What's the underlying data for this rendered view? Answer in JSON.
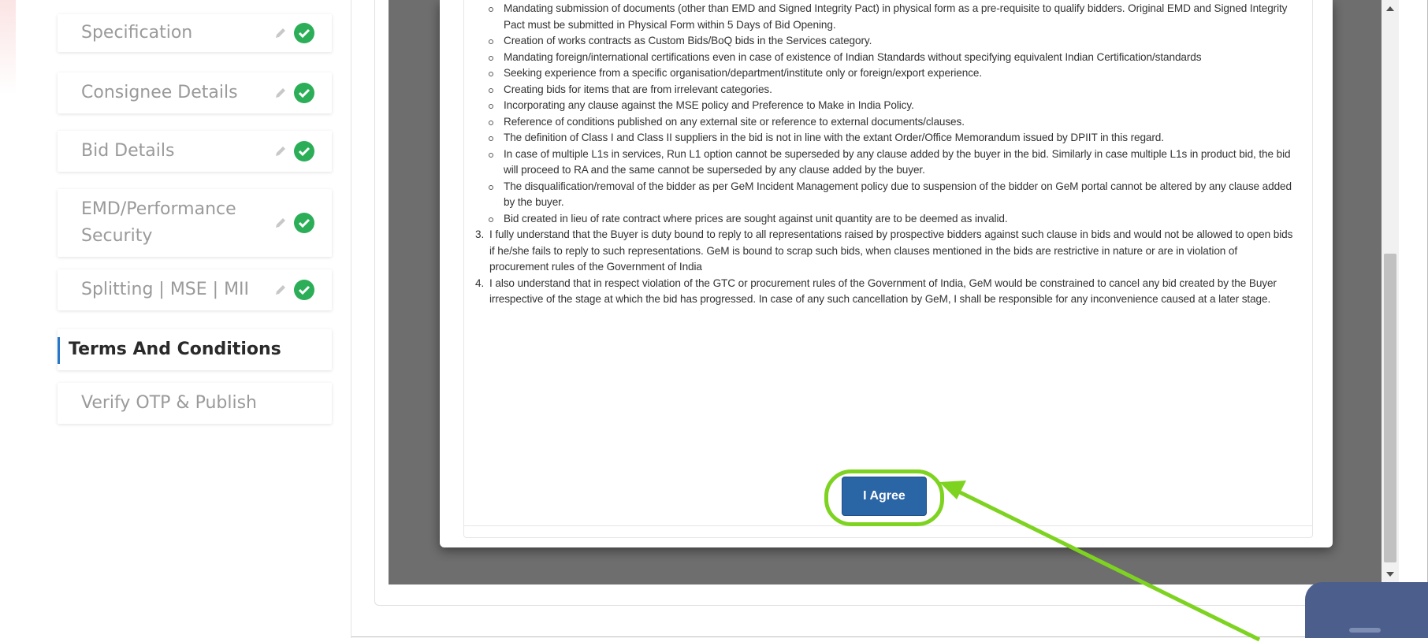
{
  "sidebar": {
    "steps": [
      {
        "label": "Specification"
      },
      {
        "label": "Consignee Details"
      },
      {
        "label": "Bid Details"
      },
      {
        "label": "EMD/Performance",
        "label2": "Security"
      },
      {
        "label": "Splitting | MSE | MII"
      },
      {
        "label": "Terms And Conditions"
      },
      {
        "label": "Verify OTP & Publish"
      }
    ]
  },
  "terms": {
    "sub_items": [
      "Mandating submission of documents (other than EMD and Signed Integrity Pact) in physical form as a pre-requisite to qualify bidders. Original EMD and Signed Integrity Pact must be submitted in Physical Form within 5 Days of Bid Opening.",
      "Creation of works contracts as Custom Bids/BoQ bids in the Services category.",
      "Mandating foreign/international certifications even in case of existence of Indian Standards without specifying equivalent Indian Certification/standards",
      "Seeking experience from a specific organisation/department/institute only or foreign/export experience.",
      "Creating bids for items that are from irrelevant categories.",
      "Incorporating any clause against the MSE policy and Preference to Make in India Policy.",
      "Reference of conditions published on any external site or reference to external documents/clauses.",
      "The definition of Class I and Class II suppliers in the bid is not in line with the extant Order/Office Memorandum issued by DPIIT in this regard.",
      "In case of multiple L1s in services, Run L1 option cannot be superseded by any clause added by the buyer in the bid. Similarly in case multiple L1s in product bid, the bid will proceed to RA and the same cannot be superseded by any clause added by the buyer.",
      "The disqualification/removal of the bidder as per GeM Incident Management policy due to suspension of the bidder on GeM portal cannot be altered by any clause added by the buyer.",
      "Bid created in lieu of rate contract where prices are sought against unit quantity are to be deemed as invalid."
    ],
    "numbered": [
      {
        "n": "3.",
        "text": "I fully understand that the Buyer is duty bound to reply to all representations raised by prospective bidders against such clause in bids and would not be allowed to open bids if he/she fails to reply to such representations. GeM is bound to scrap such bids, when clauses mentioned in the bids are restrictive in nature or are in violation of procurement rules of the Government of India"
      },
      {
        "n": "4.",
        "text": "I also understand that in respect violation of the GTC or procurement rules of the Government of India, GeM would be constrained to cancel any bid created by the Buyer irrespective of the stage at which the bid has progressed. In case of any such cancellation by GeM, I shall be responsible for any inconvenience caused at a later stage."
      }
    ]
  },
  "agree_button": {
    "label": "I Agree"
  },
  "colors": {
    "accent_blue": "#2a65a6",
    "highlight_green": "#7ed321",
    "check_green": "#2bae57",
    "overlay_gray": "#6e6e6e"
  },
  "icons": {
    "edit": "pencil-icon",
    "done": "check-circle-icon"
  }
}
